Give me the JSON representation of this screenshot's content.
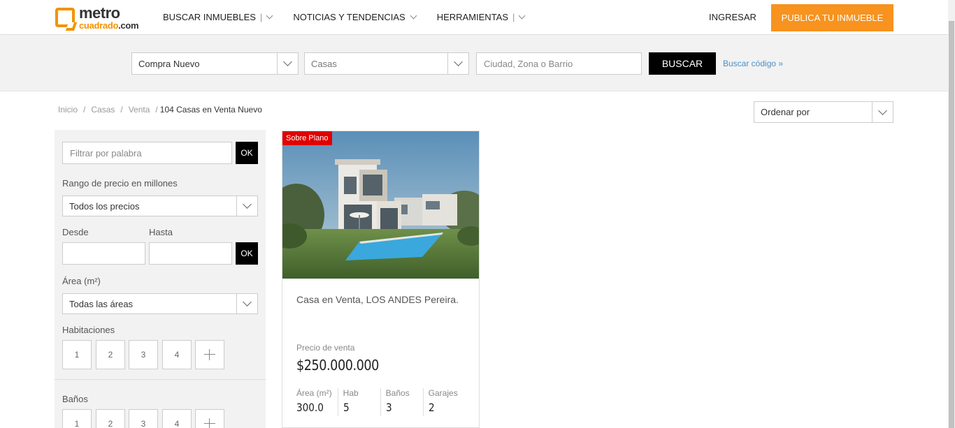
{
  "header": {
    "logo_top": "metro",
    "logo_bottom_a": "cuadrado",
    "logo_bottom_b": ".com",
    "nav": [
      {
        "label": "BUSCAR INMUEBLES"
      },
      {
        "label": "NOTICIAS Y TENDENCIAS"
      },
      {
        "label": "HERRAMIENTAS"
      }
    ],
    "nav_sep": "|",
    "login_label": "INGRESAR",
    "publish_label": "PUBLICA TU INMUEBLE"
  },
  "search": {
    "operation": "Compra Nuevo",
    "property_type": "Casas",
    "location_placeholder": "Ciudad, Zona o Barrio",
    "search_label": "BUSCAR",
    "code_link": "Buscar código »"
  },
  "breadcrumb": {
    "items": [
      "Inicio",
      "Casas",
      "Venta"
    ],
    "sep": "/",
    "current": "104  Casas en Venta Nuevo"
  },
  "order": {
    "label": "Ordenar por"
  },
  "filters": {
    "keyword_placeholder": "Filtrar por palabra",
    "ok_label": "OK",
    "price_range_label": "Rango de precio en millones",
    "price_range_value": "Todos los precios",
    "from_label": "Desde",
    "to_label": "Hasta",
    "area_label": "Área (m²)",
    "area_value": "Todas las áreas",
    "rooms_label": "Habitaciones",
    "rooms_options": [
      "1",
      "2",
      "3",
      "4"
    ],
    "baths_label": "Baños",
    "baths_options": [
      "1",
      "2",
      "3",
      "4"
    ]
  },
  "listing": {
    "badge": "Sobre Plano",
    "title": "Casa en Venta, LOS ANDES Pereira.",
    "price_label": "Precio de venta",
    "price": "$250.000.000",
    "specs": [
      {
        "label": "Área (m²)",
        "value": "300.0"
      },
      {
        "label": "Hab",
        "value": "5"
      },
      {
        "label": "Baños",
        "value": "3"
      },
      {
        "label": "Garajes",
        "value": "2"
      }
    ]
  },
  "colors": {
    "brand_orange": "#f7931e",
    "badge_red": "#e00000",
    "link_blue": "#4a90c8"
  }
}
